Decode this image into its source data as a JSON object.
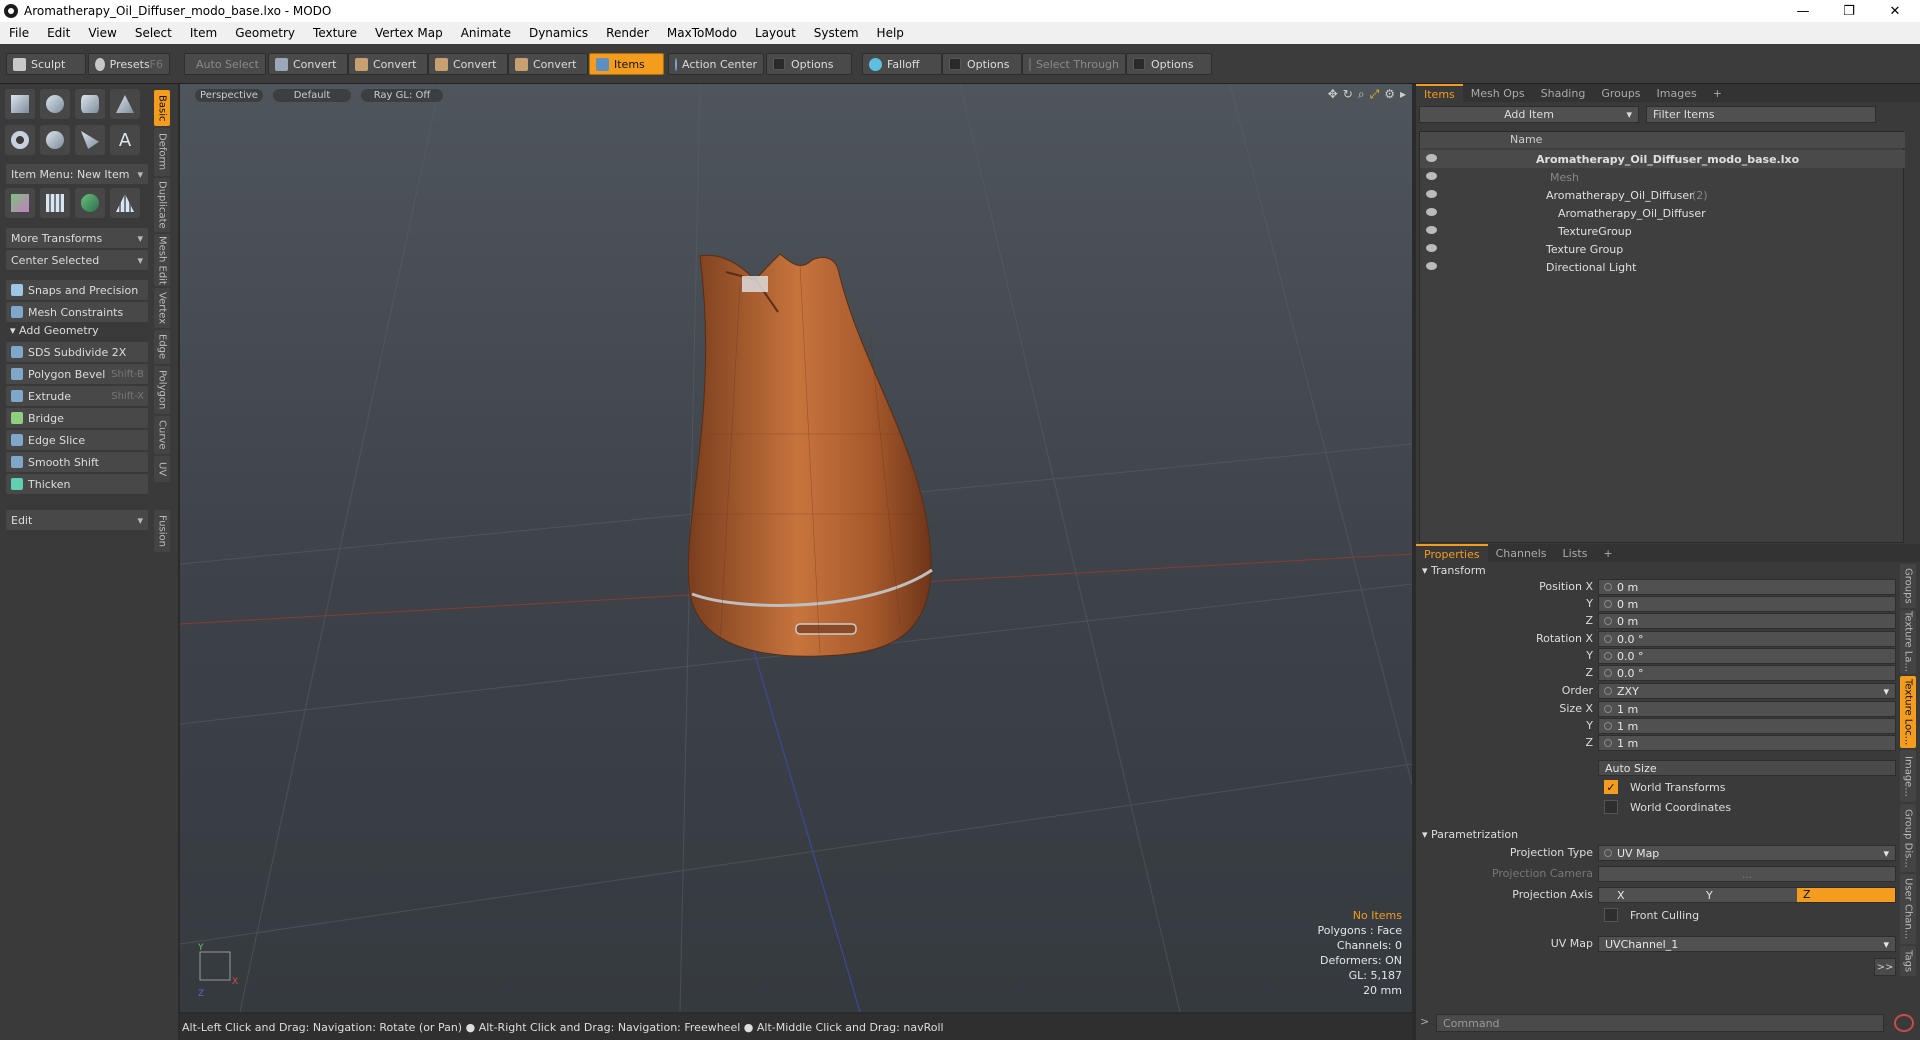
{
  "window": {
    "title": "Aromatherapy_Oil_Diffuser_modo_base.lxo - MODO"
  },
  "menu": [
    "File",
    "Edit",
    "View",
    "Select",
    "Item",
    "Geometry",
    "Texture",
    "Vertex Map",
    "Animate",
    "Dynamics",
    "Render",
    "MaxToModo",
    "Layout",
    "System",
    "Help"
  ],
  "toolbar": {
    "sculpt": "Sculpt",
    "presets": "Presets",
    "presets_key": "F6",
    "auto_select": "Auto Select",
    "convert": "Convert",
    "items": "Items",
    "action_center": "Action Center",
    "options": "Options",
    "falloff": "Falloff",
    "select_through": "Select Through"
  },
  "left": {
    "item_menu": "Item Menu: New Item",
    "more_transforms": "More Transforms",
    "center_selected": "Center Selected",
    "snaps": "Snaps and Precision",
    "constraints": "Mesh Constraints",
    "add_geometry": "Add Geometry",
    "tools": [
      {
        "label": "SDS Subdivide 2X",
        "shortcut": ""
      },
      {
        "label": "Polygon Bevel",
        "shortcut": "Shift-B"
      },
      {
        "label": "Extrude",
        "shortcut": "Shift-X"
      },
      {
        "label": "Bridge",
        "shortcut": ""
      },
      {
        "label": "Edge Slice",
        "shortcut": ""
      },
      {
        "label": "Smooth Shift",
        "shortcut": ""
      },
      {
        "label": "Thicken",
        "shortcut": ""
      }
    ],
    "edit": "Edit",
    "vtabs": [
      "Basic",
      "Deform",
      "Duplicate",
      "Mesh Edit",
      "Vertex",
      "Edge",
      "Polygon",
      "Curve",
      "UV",
      "Fusion"
    ]
  },
  "viewport": {
    "perspective": "Perspective",
    "default": "Default",
    "raygl": "Ray GL: Off",
    "info": {
      "items": "No Items",
      "polygons": "Polygons : Face",
      "channels": "Channels: 0",
      "deformers": "Deformers: ON",
      "gl": "GL: 5,187",
      "scale": "20 mm"
    },
    "status": "Alt-Left Click and Drag: Navigation: Rotate (or Pan) ● Alt-Right Click and Drag: Navigation: Freewheel ● Alt-Middle Click and Drag: navRoll"
  },
  "items_panel": {
    "tabs": [
      "Items",
      "Mesh Ops",
      "Shading",
      "Groups",
      "Images",
      "+"
    ],
    "add_item": "Add Item",
    "filter": "Filter Items",
    "col_name": "Name",
    "tree": [
      {
        "label": "Aromatherapy_Oil_Diffuser_modo_base.lxo",
        "count": ""
      },
      {
        "label": "Mesh",
        "count": ""
      },
      {
        "label": "Aromatherapy_Oil_Diffuser",
        "count": "(2)"
      },
      {
        "label": "Aromatherapy_Oil_Diffuser",
        "count": ""
      },
      {
        "label": "TextureGroup",
        "count": ""
      },
      {
        "label": "Texture Group",
        "count": ""
      },
      {
        "label": "Directional Light",
        "count": ""
      }
    ]
  },
  "props": {
    "tabs": [
      "Properties",
      "Channels",
      "Lists",
      "+"
    ],
    "transform": "Transform",
    "pos_x_l": "Position X",
    "pos_x": "0 m",
    "y_l": "Y",
    "pos_y": "0 m",
    "z_l": "Z",
    "pos_z": "0 m",
    "rot_x_l": "Rotation X",
    "rot_x": "0.0 °",
    "rot_y": "0.0 °",
    "rot_z": "0.0 °",
    "order_l": "Order",
    "order": "ZXY",
    "size_x_l": "Size X",
    "size_x": "1 m",
    "size_y": "1 m",
    "size_z": "1 m",
    "auto_size": "Auto Size",
    "world_transforms": "World Transforms",
    "world_coords": "World Coordinates",
    "param": "Parametrization",
    "proj_type_l": "Projection Type",
    "proj_type": "UV Map",
    "proj_cam_l": "Projection Camera",
    "proj_cam": "...",
    "proj_axis_l": "Projection Axis",
    "axis_x": "X",
    "axis_y": "Y",
    "axis_z": "Z",
    "front_culling": "Front Culling",
    "uvmap_l": "UV Map",
    "uvmap": "UVChannel_1",
    "vtabs": [
      "Groups",
      "Texture La...",
      "Texture Loc...",
      "Image...",
      "Group Dis...",
      "User Chan...",
      "Tags"
    ],
    "command": "Command",
    "more": ">>"
  },
  "colors": {
    "accent": "#f39c1e"
  }
}
